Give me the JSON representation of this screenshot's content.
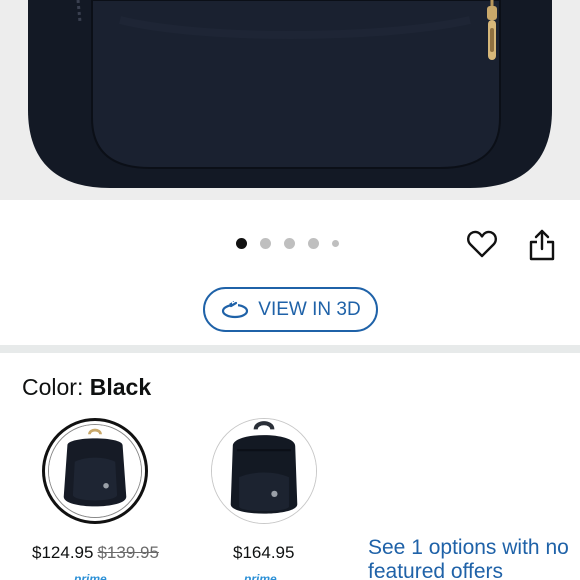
{
  "gallery": {
    "dot_count": 5,
    "active_index": 0
  },
  "actions": {
    "view3d_label": "VIEW IN 3D"
  },
  "color": {
    "label": "Color: ",
    "value": "Black"
  },
  "swatches": [
    {
      "price": "$124.95",
      "list_price": "$139.95",
      "badge": "prime"
    },
    {
      "price": "$164.95",
      "badge": "prime"
    }
  ],
  "offers_link": "See 1 options with no featured offers",
  "colors": {
    "link": "#1f62a8",
    "divider": "#e7eaea",
    "product": "#141a24"
  }
}
